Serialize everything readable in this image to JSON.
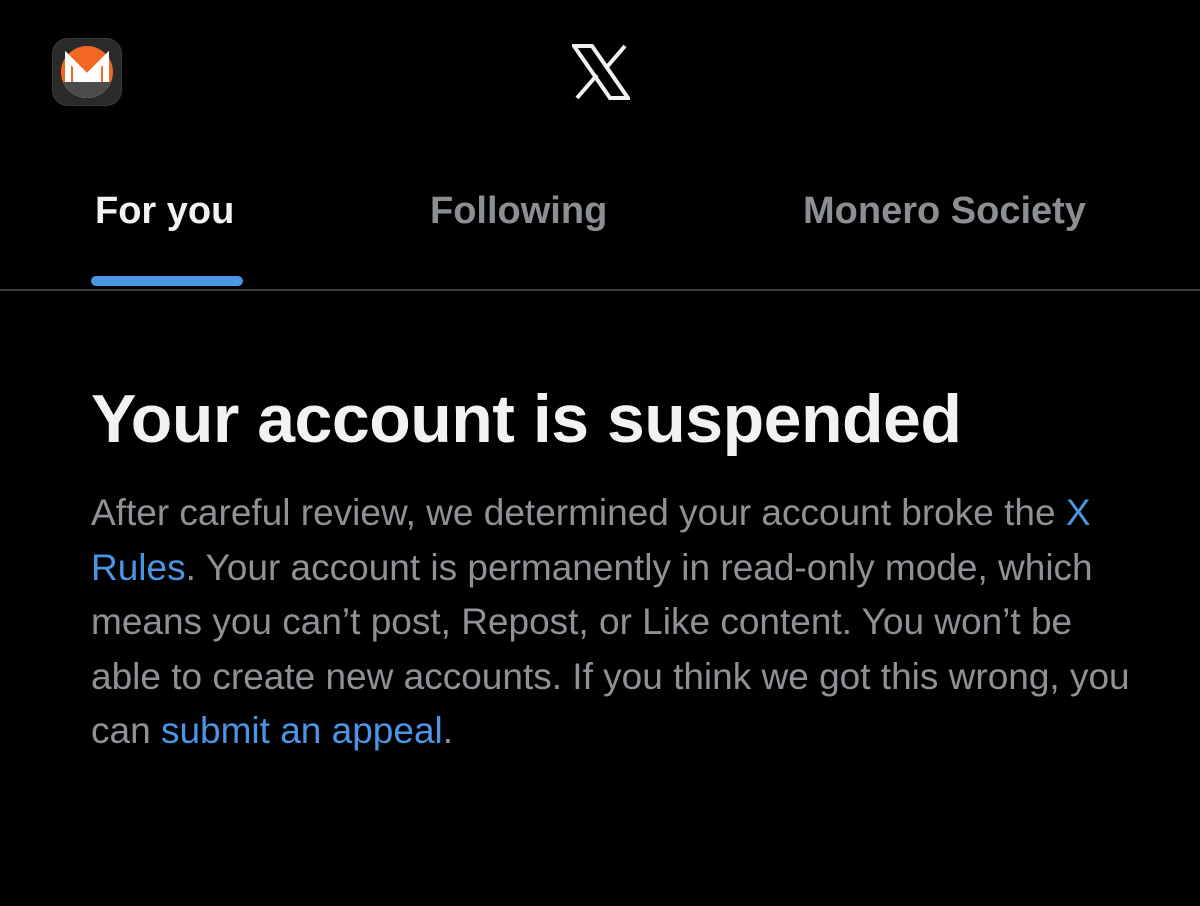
{
  "header": {
    "avatar_icon": "monero-logo-icon",
    "logo_icon": "x-logo-icon"
  },
  "tabs": [
    {
      "label": "For you",
      "active": true
    },
    {
      "label": "Following",
      "active": false
    },
    {
      "label": "Monero Society",
      "active": false
    }
  ],
  "notice": {
    "title": "Your account is suspended",
    "body_part1": "After careful review, we determined your account broke the ",
    "rules_link": "X Rules",
    "body_part2": ". Your account is permanently in read-only mode, which means you can’t post, Repost, or Like content. You won’t be able to create new accounts. If you think we got this wrong, you can ",
    "appeal_link": "submit an appeal",
    "body_end": "."
  },
  "colors": {
    "background": "#000000",
    "accent": "#4a95e4",
    "monero_orange": "#f26822",
    "text_primary": "#f0f2f3",
    "text_secondary": "#8e9196"
  }
}
